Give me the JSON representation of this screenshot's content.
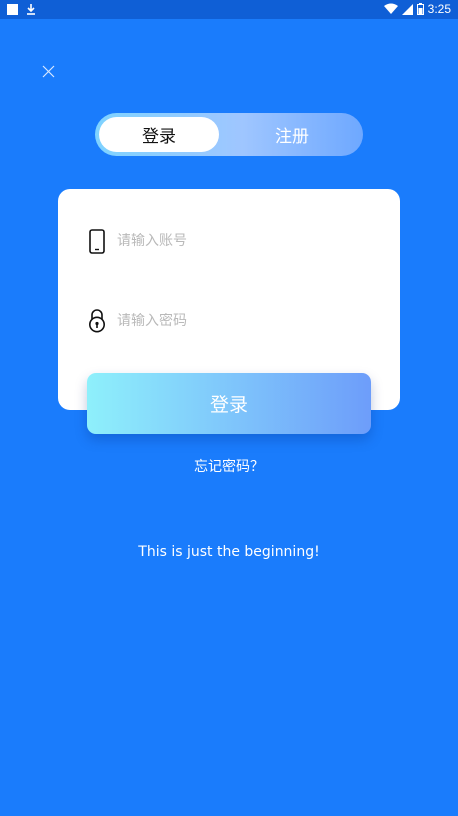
{
  "status_bar": {
    "time": "3:25",
    "left_icons": [
      "notification-square-icon",
      "download-icon"
    ],
    "right_icons": [
      "wifi-icon",
      "signal-icon",
      "battery-icon"
    ]
  },
  "close_icon": "close-icon",
  "tabs": {
    "login_label": "登录",
    "register_label": "注册",
    "active": "login"
  },
  "form": {
    "account": {
      "placeholder": "请输入账号",
      "value": "",
      "icon": "phone-icon"
    },
    "password": {
      "placeholder": "请输入密码",
      "value": "",
      "icon": "lock-icon"
    },
    "submit_label": "登录"
  },
  "forgot_password": "忘记密码？",
  "tagline": "This is just the beginning!",
  "colors": {
    "background": "#1a7cfc",
    "status_bar": "#0f5fd6",
    "card": "#ffffff",
    "button_gradient_start": "#8ef0fb",
    "button_gradient_end": "#6d9dfa"
  }
}
